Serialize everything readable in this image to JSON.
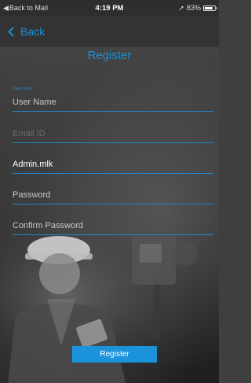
{
  "status_bar": {
    "back_app": "Back to Mail",
    "time": "4:19 PM",
    "battery": "83%",
    "battery_level": 0.83
  },
  "nav": {
    "back_label": "Back"
  },
  "page": {
    "title": "Register"
  },
  "form": {
    "username_label": "User name",
    "username_placeholder": "User Name",
    "email_placeholder": "Email ID",
    "admin_value": "Admin.mlk",
    "password_placeholder": "Password",
    "confirm_placeholder": "Confirm Password"
  },
  "actions": {
    "register_label": "Register"
  },
  "colors": {
    "accent": "#1a93db"
  }
}
